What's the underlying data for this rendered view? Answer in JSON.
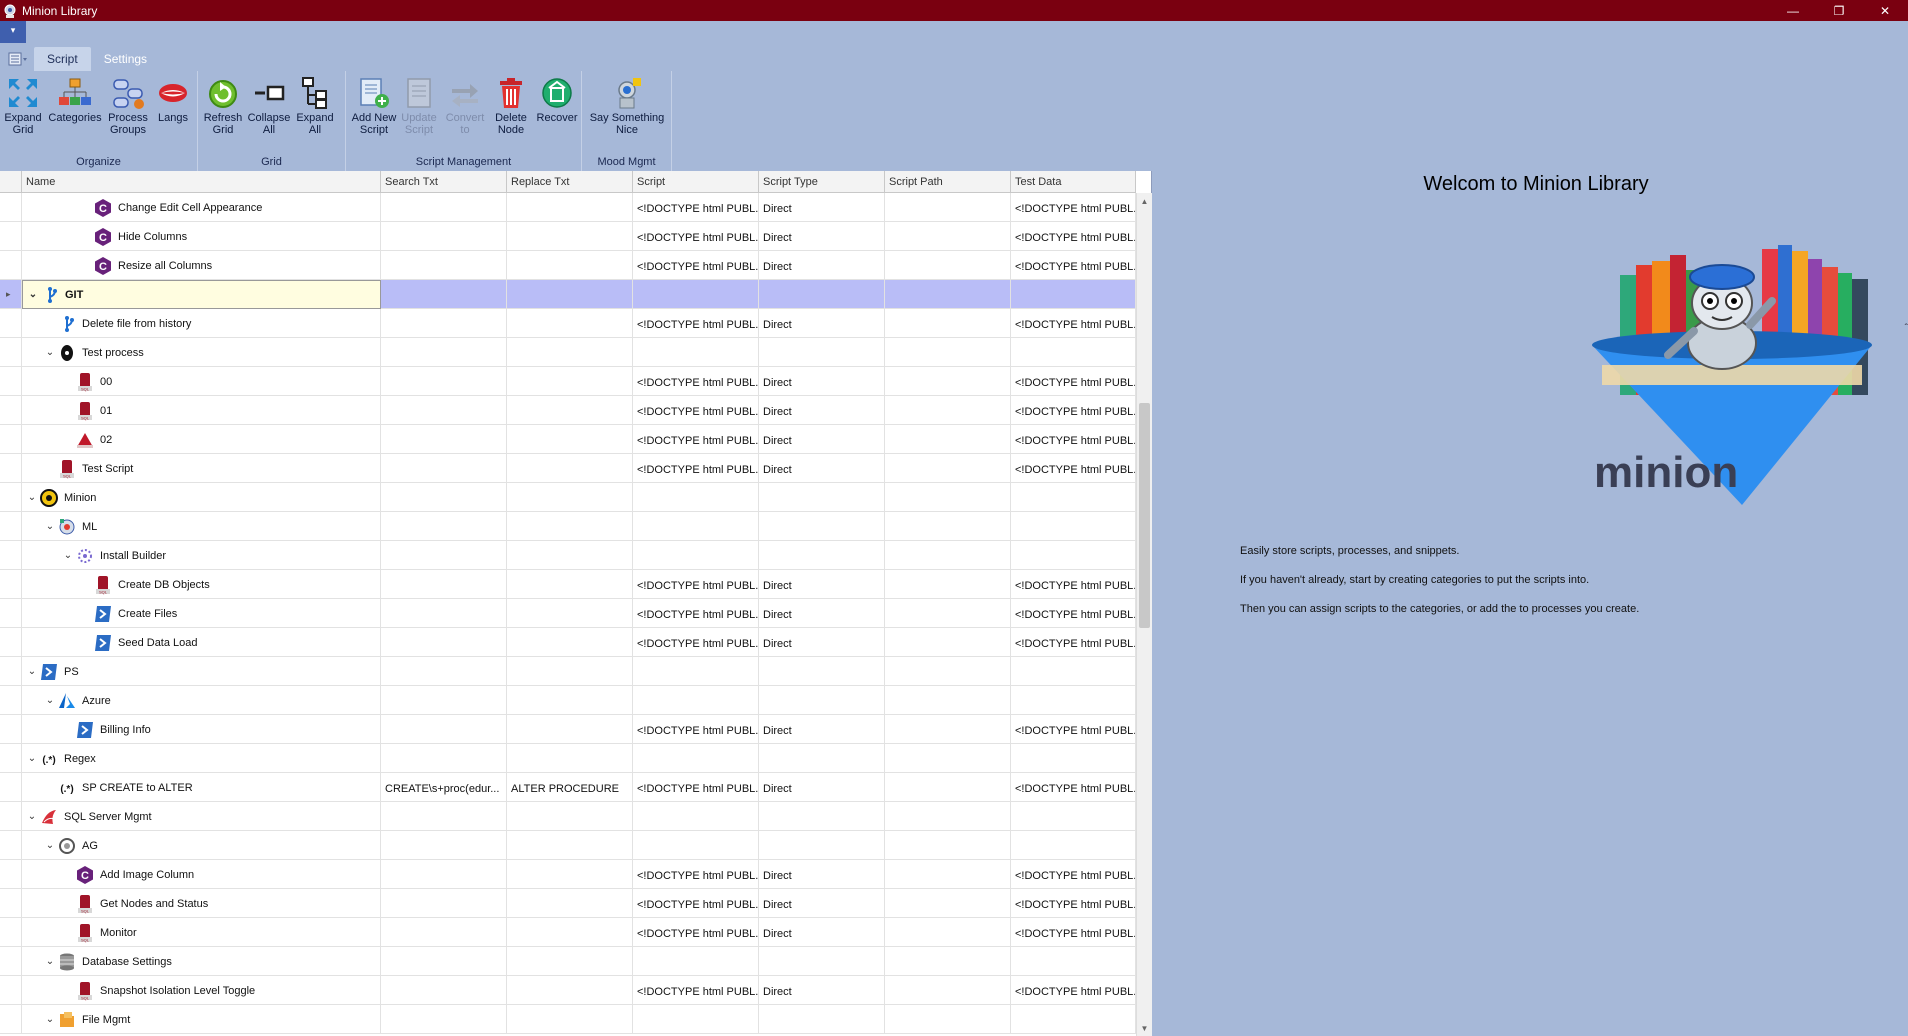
{
  "window": {
    "title": "Minion Library",
    "minimize": "—",
    "maximize": "❐",
    "close": "✕"
  },
  "qat": {
    "dropdown": "▾"
  },
  "tabs": [
    {
      "label": "Script",
      "active": true
    },
    {
      "label": "Settings",
      "active": false
    }
  ],
  "ribbon": {
    "groups": [
      {
        "label": "Organize",
        "buttons": [
          {
            "label": "Expand\nGrid",
            "icon": "expand-grid-icon"
          },
          {
            "label": "Categories",
            "icon": "categories-icon"
          },
          {
            "label": "Process\nGroups",
            "icon": "process-groups-icon"
          },
          {
            "label": "Langs",
            "icon": "langs-icon"
          }
        ]
      },
      {
        "label": "Grid",
        "buttons": [
          {
            "label": "Refresh\nGrid",
            "icon": "refresh-icon"
          },
          {
            "label": "Collapse\nAll",
            "icon": "collapse-all-icon"
          },
          {
            "label": "Expand\nAll",
            "icon": "expand-all-icon"
          }
        ]
      },
      {
        "label": "Script Management",
        "buttons": [
          {
            "label": "Add New\nScript",
            "icon": "add-script-icon"
          },
          {
            "label": "Update\nScript",
            "icon": "update-script-icon",
            "disabled": true
          },
          {
            "label": "Convert\nto",
            "icon": "convert-icon",
            "disabled": true
          },
          {
            "label": "Delete\nNode",
            "icon": "delete-icon"
          },
          {
            "label": "Recover",
            "icon": "recover-icon"
          }
        ]
      },
      {
        "label": "Mood Mgmt",
        "buttons": [
          {
            "label": "Say Something\nNice",
            "icon": "say-nice-icon"
          }
        ]
      }
    ]
  },
  "grid": {
    "columns": [
      "Name",
      "Search Txt",
      "Replace Txt",
      "Script",
      "Script Type",
      "Script Path",
      "Test Data"
    ],
    "rows": [
      {
        "level": 4,
        "expander": "",
        "icon": "csharp",
        "name": "Change Edit Cell Appearance",
        "search": "",
        "replace": "",
        "script": "<!DOCTYPE html PUBL...",
        "type": "Direct",
        "path": "",
        "test": "<!DOCTYPE html PUBL..."
      },
      {
        "level": 4,
        "expander": "",
        "icon": "csharp",
        "name": "Hide Columns",
        "search": "",
        "replace": "",
        "script": "<!DOCTYPE html PUBL...",
        "type": "Direct",
        "path": "",
        "test": "<!DOCTYPE html PUBL..."
      },
      {
        "level": 4,
        "expander": "",
        "icon": "csharp",
        "name": "Resize all Columns",
        "search": "",
        "replace": "",
        "script": "<!DOCTYPE html PUBL...",
        "type": "Direct",
        "path": "",
        "test": "<!DOCTYPE html PUBL..."
      },
      {
        "level": 1,
        "expander": "⌄",
        "icon": "git",
        "name": "GIT",
        "search": "",
        "replace": "",
        "script": "",
        "type": "",
        "path": "",
        "test": "",
        "selected": true,
        "indicator": "▸"
      },
      {
        "level": 2,
        "expander": "",
        "icon": "git",
        "name": "Delete file from history",
        "search": "",
        "replace": "",
        "script": "<!DOCTYPE html PUBL...",
        "type": "Direct",
        "path": "",
        "test": "<!DOCTYPE html PUBL..."
      },
      {
        "level": 2,
        "expander": "⌄",
        "icon": "process",
        "name": "Test process",
        "search": "",
        "replace": "",
        "script": "",
        "type": "",
        "path": "",
        "test": ""
      },
      {
        "level": 3,
        "expander": "",
        "icon": "sql",
        "name": "00",
        "search": "",
        "replace": "",
        "script": "<!DOCTYPE html PUBL...",
        "type": "Direct",
        "path": "",
        "test": "<!DOCTYPE html PUBL..."
      },
      {
        "level": 3,
        "expander": "",
        "icon": "sql",
        "name": "01",
        "search": "",
        "replace": "",
        "script": "<!DOCTYPE html PUBL...",
        "type": "Direct",
        "path": "",
        "test": "<!DOCTYPE html PUBL..."
      },
      {
        "level": 3,
        "expander": "",
        "icon": "warning",
        "name": "02",
        "search": "",
        "replace": "",
        "script": "<!DOCTYPE html PUBL...",
        "type": "Direct",
        "path": "",
        "test": "<!DOCTYPE html PUBL..."
      },
      {
        "level": 2,
        "expander": "",
        "icon": "sql",
        "name": "Test Script",
        "search": "",
        "replace": "",
        "script": "<!DOCTYPE html PUBL...",
        "type": "Direct",
        "path": "",
        "test": "<!DOCTYPE html PUBL..."
      },
      {
        "level": 1,
        "expander": "⌄",
        "icon": "minion",
        "name": "Minion",
        "search": "",
        "replace": "",
        "script": "",
        "type": "",
        "path": "",
        "test": ""
      },
      {
        "level": 2,
        "expander": "⌄",
        "icon": "ml",
        "name": "ML",
        "search": "",
        "replace": "",
        "script": "",
        "type": "",
        "path": "",
        "test": ""
      },
      {
        "level": 3,
        "expander": "⌄",
        "icon": "installer",
        "name": "Install Builder",
        "search": "",
        "replace": "",
        "script": "",
        "type": "",
        "path": "",
        "test": ""
      },
      {
        "level": 4,
        "expander": "",
        "icon": "sql",
        "name": "Create DB Objects",
        "search": "",
        "replace": "",
        "script": "<!DOCTYPE html PUBL...",
        "type": "Direct",
        "path": "",
        "test": "<!DOCTYPE html PUBL..."
      },
      {
        "level": 4,
        "expander": "",
        "icon": "ps",
        "name": "Create Files",
        "search": "",
        "replace": "",
        "script": "<!DOCTYPE html PUBL...",
        "type": "Direct",
        "path": "",
        "test": "<!DOCTYPE html PUBL..."
      },
      {
        "level": 4,
        "expander": "",
        "icon": "ps",
        "name": "Seed Data Load",
        "search": "",
        "replace": "",
        "script": "<!DOCTYPE html PUBL...",
        "type": "Direct",
        "path": "",
        "test": "<!DOCTYPE html PUBL..."
      },
      {
        "level": 1,
        "expander": "⌄",
        "icon": "ps",
        "name": "PS",
        "search": "",
        "replace": "",
        "script": "",
        "type": "",
        "path": "",
        "test": ""
      },
      {
        "level": 2,
        "expander": "⌄",
        "icon": "azure",
        "name": "Azure",
        "search": "",
        "replace": "",
        "script": "",
        "type": "",
        "path": "",
        "test": ""
      },
      {
        "level": 3,
        "expander": "",
        "icon": "ps",
        "name": "Billing Info",
        "search": "",
        "replace": "",
        "script": "<!DOCTYPE html PUBL...",
        "type": "Direct",
        "path": "",
        "test": "<!DOCTYPE html PUBL..."
      },
      {
        "level": 1,
        "expander": "⌄",
        "icon": "regex",
        "name": "Regex",
        "search": "",
        "replace": "",
        "script": "",
        "type": "",
        "path": "",
        "test": ""
      },
      {
        "level": 2,
        "expander": "",
        "icon": "regex",
        "name": "SP CREATE to ALTER",
        "search": "CREATE\\s+proc(edur...",
        "replace": "ALTER PROCEDURE",
        "script": "<!DOCTYPE html PUBL...",
        "type": "Direct",
        "path": "",
        "test": "<!DOCTYPE html PUBL..."
      },
      {
        "level": 1,
        "expander": "⌄",
        "icon": "sqlserver",
        "name": "SQL Server Mgmt",
        "search": "",
        "replace": "",
        "script": "",
        "type": "",
        "path": "",
        "test": ""
      },
      {
        "level": 2,
        "expander": "⌄",
        "icon": "ag",
        "name": "AG",
        "search": "",
        "replace": "",
        "script": "",
        "type": "",
        "path": "",
        "test": ""
      },
      {
        "level": 3,
        "expander": "",
        "icon": "csharp",
        "name": "Add Image Column",
        "search": "",
        "replace": "",
        "script": "<!DOCTYPE html PUBL...",
        "type": "Direct",
        "path": "",
        "test": "<!DOCTYPE html PUBL..."
      },
      {
        "level": 3,
        "expander": "",
        "icon": "sql",
        "name": "Get Nodes and Status",
        "search": "",
        "replace": "",
        "script": "<!DOCTYPE html PUBL...",
        "type": "Direct",
        "path": "",
        "test": "<!DOCTYPE html PUBL..."
      },
      {
        "level": 3,
        "expander": "",
        "icon": "sql",
        "name": "Monitor",
        "search": "",
        "replace": "",
        "script": "<!DOCTYPE html PUBL...",
        "type": "Direct",
        "path": "",
        "test": "<!DOCTYPE html PUBL..."
      },
      {
        "level": 2,
        "expander": "⌄",
        "icon": "database",
        "name": "Database Settings",
        "search": "",
        "replace": "",
        "script": "",
        "type": "",
        "path": "",
        "test": ""
      },
      {
        "level": 3,
        "expander": "",
        "icon": "sql",
        "name": "Snapshot Isolation Level Toggle",
        "search": "",
        "replace": "",
        "script": "<!DOCTYPE html PUBL...",
        "type": "Direct",
        "path": "",
        "test": "<!DOCTYPE html PUBL..."
      },
      {
        "level": 2,
        "expander": "⌄",
        "icon": "files",
        "name": "File Mgmt",
        "search": "",
        "replace": "",
        "script": "",
        "type": "",
        "path": "",
        "test": ""
      }
    ]
  },
  "welcome": {
    "title": "Welcom to Minion Library",
    "logo_text": "minion",
    "lines": [
      "Easily store scripts, processes, and snippets.",
      "If you haven't already, start by creating categories to put the scripts into.",
      "Then you can assign scripts to the categories, or add the to processes you create."
    ]
  },
  "colors": {
    "titlebar": "#7a0010",
    "background": "#a6b8d8",
    "selected_row": "#b9bdf7"
  }
}
